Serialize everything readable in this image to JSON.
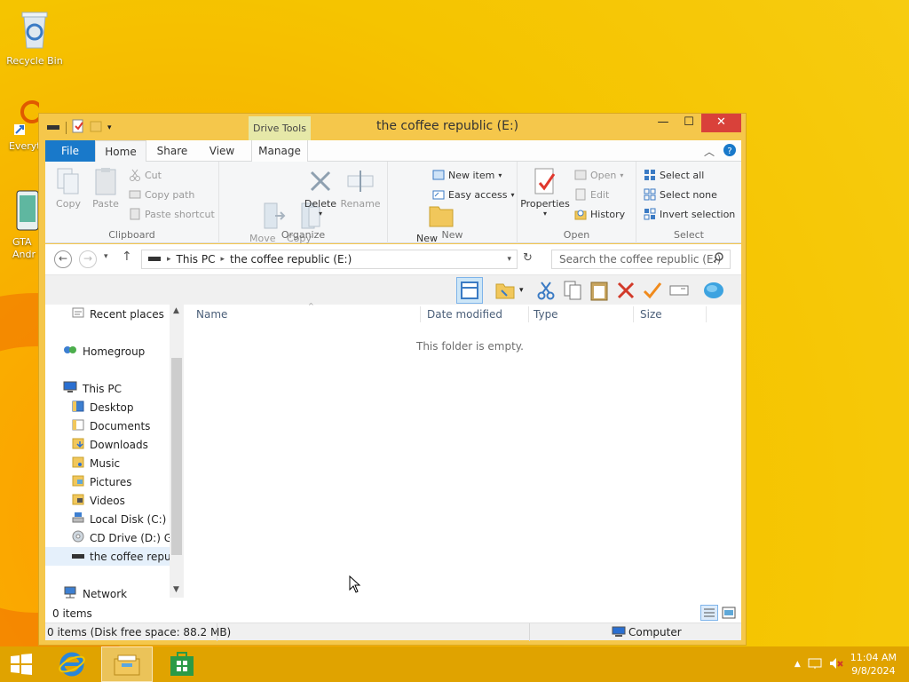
{
  "desktop": {
    "icons": [
      {
        "label": "Recycle Bin"
      },
      {
        "label": "Everyt"
      },
      {
        "label": "GTA\nAndr"
      }
    ]
  },
  "window": {
    "title": "the coffee republic (E:)",
    "contextual_tab_group": "Drive Tools",
    "tabs": [
      {
        "label": "File"
      },
      {
        "label": "Home"
      },
      {
        "label": "Share"
      },
      {
        "label": "View"
      },
      {
        "label": "Manage"
      }
    ],
    "buttons": {
      "minimize": "—",
      "maximize": "☐",
      "close": "✕"
    }
  },
  "ribbon": {
    "clipboard": {
      "label": "Clipboard",
      "copy": "Copy",
      "paste": "Paste",
      "cut": "Cut",
      "copy_path": "Copy path",
      "paste_shortcut": "Paste shortcut"
    },
    "organize": {
      "label": "Organize",
      "move_to": "Move\nto",
      "copy_to": "Copy\nto",
      "delete": "Delete",
      "rename": "Rename"
    },
    "new": {
      "label": "New",
      "new_folder": "New\nfolder",
      "new_item": "New item",
      "easy_access": "Easy access"
    },
    "open": {
      "label": "Open",
      "properties": "Properties",
      "open": "Open",
      "edit": "Edit",
      "history": "History"
    },
    "select": {
      "label": "Select",
      "select_all": "Select all",
      "select_none": "Select none",
      "invert_selection": "Invert selection"
    }
  },
  "address": {
    "crumbs": [
      "This PC",
      "the coffee republic (E:)"
    ],
    "search_placeholder": "Search the coffee republic (E:)"
  },
  "nav": {
    "items": [
      {
        "label": "Recent places"
      },
      {
        "label": "Homegroup"
      },
      {
        "label": "This PC"
      },
      {
        "label": "Desktop"
      },
      {
        "label": "Documents"
      },
      {
        "label": "Downloads"
      },
      {
        "label": "Music"
      },
      {
        "label": "Pictures"
      },
      {
        "label": "Videos"
      },
      {
        "label": "Local Disk (C:)"
      },
      {
        "label": "CD Drive (D:) GSP"
      },
      {
        "label": "the coffee republ"
      },
      {
        "label": "Network"
      }
    ]
  },
  "list": {
    "columns": [
      "Name",
      "Date modified",
      "Type",
      "Size"
    ],
    "empty_message": "This folder is empty."
  },
  "status": {
    "item_count": "0 items",
    "details": "0 items (Disk free space: 88.2 MB)",
    "location": "Computer"
  },
  "taskbar": {
    "time": "11:04 AM",
    "date": "9/8/2024"
  },
  "colors": {
    "accent": "#1979ca",
    "close": "#d9413a",
    "desktop": "#f5c400"
  }
}
